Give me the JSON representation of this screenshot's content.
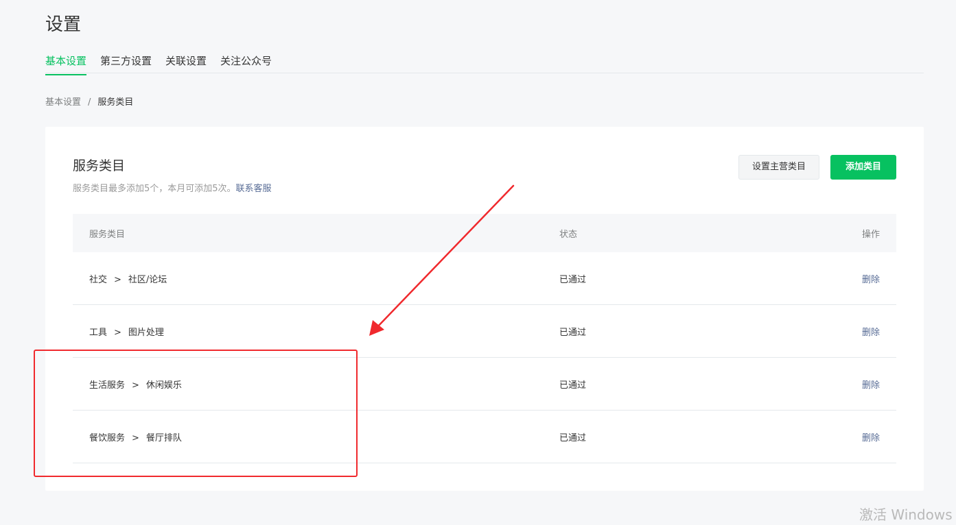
{
  "page_title": "设置",
  "tabs": [
    {
      "label": "基本设置",
      "active": true
    },
    {
      "label": "第三方设置",
      "active": false
    },
    {
      "label": "关联设置",
      "active": false
    },
    {
      "label": "关注公众号",
      "active": false
    }
  ],
  "breadcrumb": {
    "parent": "基本设置",
    "separator": "/",
    "current": "服务类目"
  },
  "card": {
    "title": "服务类目",
    "description": "服务类目最多添加5个，本月可添加5次。",
    "contact_link": "联系客服",
    "set_main_button": "设置主营类目",
    "add_button": "添加类目"
  },
  "table": {
    "headers": {
      "category": "服务类目",
      "status": "状态",
      "action": "操作"
    },
    "rows": [
      {
        "primary": "社交",
        "separator": ">",
        "secondary": "社区/论坛",
        "status": "已通过",
        "action": "删除"
      },
      {
        "primary": "工具",
        "separator": ">",
        "secondary": "图片处理",
        "status": "已通过",
        "action": "删除"
      },
      {
        "primary": "生活服务",
        "separator": ">",
        "secondary": "休闲娱乐",
        "status": "已通过",
        "action": "删除"
      },
      {
        "primary": "餐饮服务",
        "separator": ">",
        "secondary": "餐厅排队",
        "status": "已通过",
        "action": "删除"
      }
    ]
  },
  "annotation": {
    "color": "#f0292d"
  },
  "watermark": "激活 Windows",
  "colors": {
    "brand_green": "#07c160",
    "link_blue": "#576b95",
    "annotation_red": "#f0292d"
  }
}
